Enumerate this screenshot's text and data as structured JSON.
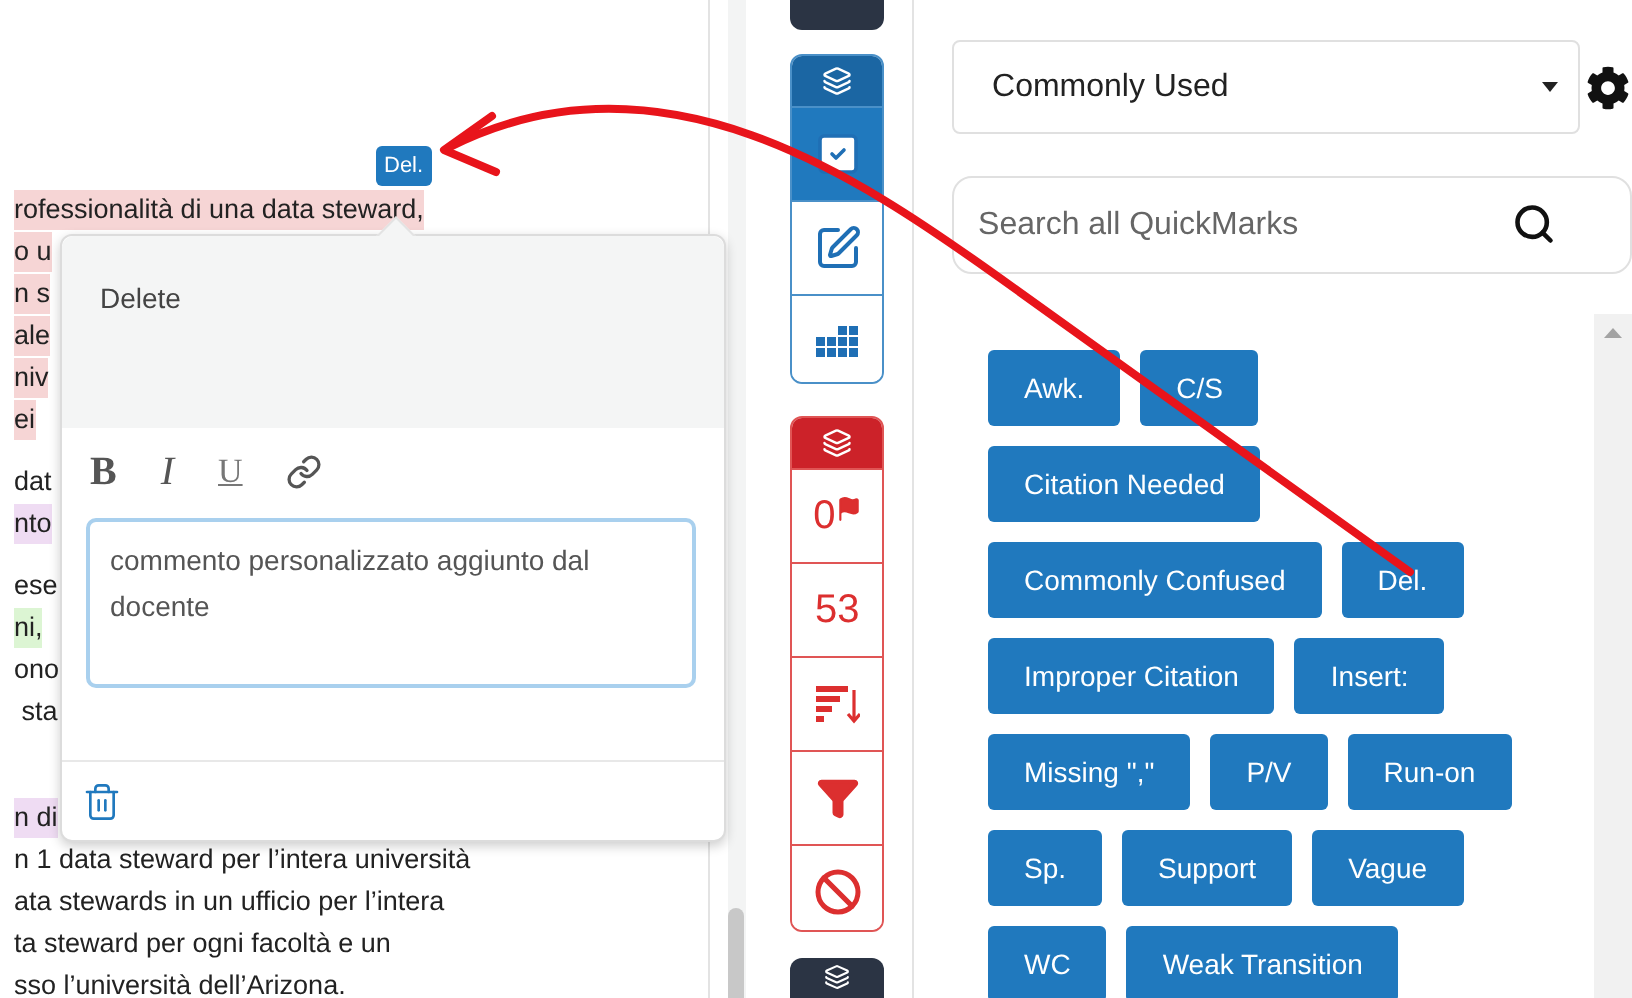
{
  "document": {
    "paragraphs": [
      {
        "lines": [
          {
            "text": "rofessionalità di una data steward,",
            "color": "#f6d5d5"
          },
          {
            "text": "o u",
            "color": "#f6d5d5"
          },
          {
            "text": "n s",
            "color": "#f6d5d5"
          },
          {
            "text": "ale",
            "color": "#f6d5d5"
          },
          {
            "text": "niv",
            "color": "#f6d5d5"
          },
          {
            "text": "ei",
            "color": "#f6d5d5"
          }
        ]
      },
      {
        "lines": [
          {
            "text": "dat"
          },
          {
            "text": "nto",
            "color": "#efdcf3"
          }
        ]
      },
      {
        "lines": [
          {
            "text": "ese"
          },
          {
            "text": "ni,",
            "color": "#dcf5d3"
          },
          {
            "text": "ono"
          },
          {
            "text": " sta"
          }
        ]
      },
      {
        "lines": [
          {
            "text": "n di",
            "color": "#efdcf3"
          },
          {
            "text": "n 1 data steward per l’intera università"
          },
          {
            "text": "ata stewards in un ufficio per l’intera"
          },
          {
            "text": "ta steward per ogni facoltà e un"
          },
          {
            "text": "sso l’università dell’Arizona."
          }
        ]
      }
    ],
    "mark_badge": "Del."
  },
  "comment_popup": {
    "title": "Delete",
    "format_buttons": [
      {
        "kind": "bold",
        "label": "B"
      },
      {
        "kind": "italic",
        "label": "I"
      },
      {
        "kind": "underline",
        "label": "U"
      },
      {
        "kind": "link"
      }
    ],
    "comment": "commento personalizzato aggiunto dal docente"
  },
  "toolbar": {
    "groups": [
      {
        "kind": "blue",
        "items": [
          {
            "kind": "check",
            "selected": true
          },
          {
            "kind": "edit",
            "selected": false
          },
          {
            "kind": "grid",
            "selected": false
          }
        ]
      },
      {
        "kind": "red",
        "items": [
          {
            "kind": "flags",
            "label": "0"
          },
          {
            "kind": "count",
            "label": "53"
          },
          {
            "kind": "sort"
          },
          {
            "kind": "filter"
          },
          {
            "kind": "ban"
          }
        ]
      }
    ]
  },
  "quickmarks": {
    "set": "Commonly Used",
    "search": {
      "placeholder": "Search all QuickMarks"
    },
    "rows": [
      [
        "Awk.",
        "C/S"
      ],
      [
        "Citation Needed"
      ],
      [
        "Commonly Confused",
        "Del."
      ],
      [
        "Improper Citation",
        "Insert:"
      ],
      [
        "Missing \",\"",
        "P/V",
        "Run-on"
      ],
      [
        "Sp.",
        "Support",
        "Vague"
      ],
      [
        "WC",
        "Weak Transition"
      ]
    ]
  }
}
